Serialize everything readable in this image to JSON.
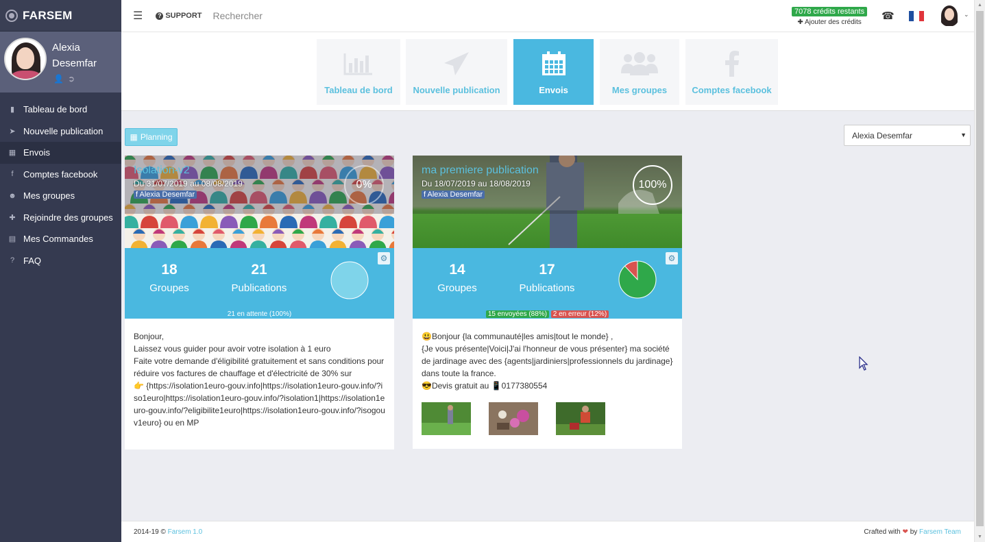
{
  "brand": {
    "name": "FARSEM"
  },
  "user": {
    "name": "Alexia Desemfar"
  },
  "nav": [
    {
      "label": "Tableau de bord",
      "icon": "chart-icon"
    },
    {
      "label": "Nouvelle publication",
      "icon": "send-icon"
    },
    {
      "label": "Envois",
      "icon": "calendar-icon",
      "active": true
    },
    {
      "label": "Comptes facebook",
      "icon": "facebook-icon"
    },
    {
      "label": "Mes groupes",
      "icon": "users-icon"
    },
    {
      "label": "Rejoindre des groupes",
      "icon": "plus-icon"
    },
    {
      "label": "Mes Commandes",
      "icon": "archive-icon"
    },
    {
      "label": "FAQ",
      "icon": "question-icon"
    }
  ],
  "topbar": {
    "support": "SUPPORT",
    "search_placeholder": "Rechercher",
    "credits": "7078 crédits restants",
    "add_credits": "Ajouter des crédits"
  },
  "tabs": [
    {
      "label": "Tableau de bord"
    },
    {
      "label": "Nouvelle publication"
    },
    {
      "label": "Envois",
      "active": true
    },
    {
      "label": "Mes groupes"
    },
    {
      "label": "Comptes facebook"
    }
  ],
  "planning_label": "Planning",
  "account_select": "Alexia Desemfar",
  "cards": [
    {
      "title": "Isolation-v2",
      "dates": "Du 31/07/2019 au 08/08/2019",
      "account": "Alexia Desemfar",
      "percent": "0%",
      "groups": "18",
      "groups_label": "Groupes",
      "publications": "21",
      "publications_label": "Publications",
      "status": "21 en attente (100%)",
      "body": [
        "Bonjour,",
        "Laissez vous guider pour avoir votre isolation à 1 euro",
        "Faite votre demande d'éligibilité gratuitement et sans conditions pour réduire vos factures de chauffage et d'électricité de 30% sur",
        "👉 {https://isolation1euro-gouv.info|https://isolation1euro-gouv.info/?iso1euro|https://isolation1euro-gouv.info/?isolation1|https://isolation1euro-gouv.info/?eligibilite1euro|https://isolation1euro-gouv.info/?isogouv1euro} ou en MP"
      ]
    },
    {
      "title": "ma premiere publication",
      "dates": "Du 18/07/2019 au 18/08/2019",
      "account": "Alexia Desemfar",
      "percent": "100%",
      "groups": "14",
      "groups_label": "Groupes",
      "publications": "17",
      "publications_label": "Publications",
      "sent": "15 envoyées (88%)",
      "errors": "2 en erreur (12%)",
      "sent_fraction": 0.88,
      "body": [
        "😃Bonjour {la communauté|les amis|tout le monde} ,",
        "{Je vous présente|Voici|J'ai l'honneur de vous présenter} ma société de jardinage avec des {agents|jardiniers|professionnels du jardinage} dans toute la france.",
        "😎Devis gratuit au 📱0177380554"
      ]
    }
  ],
  "footer": {
    "copyright": "2014-19 ©",
    "version": "Farsem 1.0",
    "crafted": "Crafted with",
    "by": "by",
    "team": "Farsem Team"
  },
  "colors": {
    "accent": "#4ab8e0",
    "sidebar": "#353a50",
    "success": "#2fa84a",
    "danger": "#d9534f"
  }
}
